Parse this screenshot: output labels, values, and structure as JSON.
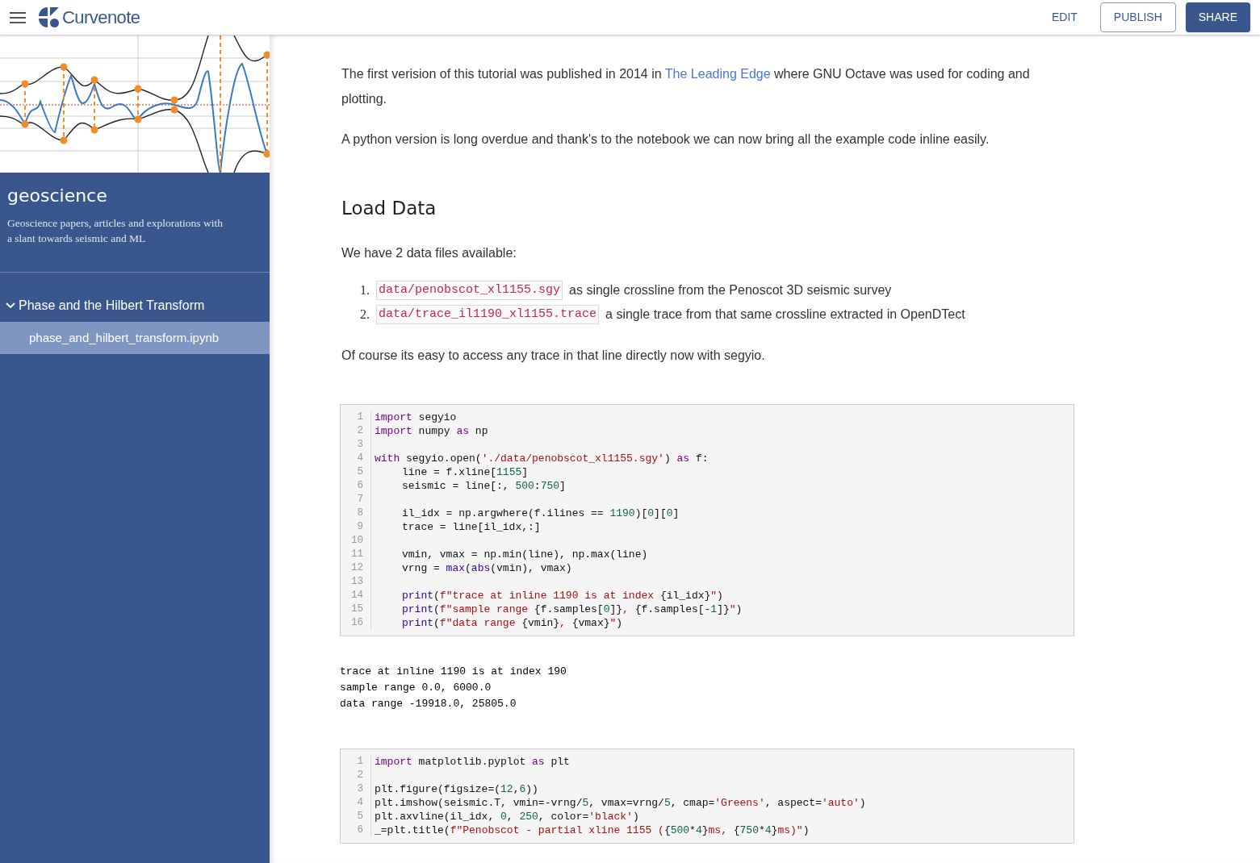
{
  "header": {
    "brand": "Curvenote",
    "actions": [
      {
        "label": "EDIT",
        "kind": "text"
      },
      {
        "label": "PUBLISH",
        "kind": "outlined"
      },
      {
        "label": "SHARE",
        "kind": "filled"
      }
    ]
  },
  "sidebar": {
    "title": "geoscience",
    "description": "Geoscience papers, articles and explorations with a slant towards seismic and ML",
    "nav": [
      {
        "label": "Phase and the Hilbert Transform",
        "expanded": true,
        "children": [
          {
            "label": "phase_and_hilbert_transform.ipynb",
            "selected": true
          }
        ]
      }
    ]
  },
  "content": [
    {
      "kind": "paragraph",
      "before": "The first verision of this tutorial was published in 2014 in ",
      "link": "The Leading Edge",
      "after": " where GNU Octave was used for coding and plotting."
    },
    {
      "kind": "paragraph",
      "before": "A python version is long overdue and thank's to the notebook we can now bring all the example code inline easily."
    },
    {
      "kind": "heading",
      "text": "Load Data"
    },
    {
      "kind": "paragraph",
      "before": "We have 2 data files available:"
    },
    {
      "kind": "list",
      "items": [
        {
          "marker": "1.",
          "code": "data/penobscot_xl1155.sgy",
          "text": "as single crossline from the Penoscot 3D seismic survey"
        },
        {
          "marker": "2.",
          "code": "data/trace_il1190_xl1155.trace",
          "text": "a single trace from that same crossline extracted in OpenDTect"
        }
      ]
    },
    {
      "kind": "paragraph",
      "before": "Of course its easy to access any trace in that line directly now with segyio."
    },
    {
      "kind": "code",
      "lines": [
        {
          "n": "1",
          "indent": false,
          "tokens": [
            {
              "kind": "keyword",
              "text": "import"
            },
            {
              "kind": "plain",
              "text": " segyio"
            }
          ]
        },
        {
          "n": "2",
          "indent": false,
          "tokens": [
            {
              "kind": "keyword",
              "text": "import"
            },
            {
              "kind": "plain",
              "text": " numpy "
            },
            {
              "kind": "keyword",
              "text": "as"
            },
            {
              "kind": "plain",
              "text": " np"
            }
          ]
        },
        {
          "n": "3",
          "indent": false
        },
        {
          "n": "4",
          "indent": false,
          "tokens": [
            {
              "kind": "keyword",
              "text": "with"
            },
            {
              "kind": "plain",
              "text": " segyio.open("
            },
            {
              "kind": "string",
              "text": "'./data/penobscot_xl1155.sgy'"
            },
            {
              "kind": "plain",
              "text": ") "
            },
            {
              "kind": "keyword",
              "text": "as"
            },
            {
              "kind": "plain",
              "text": " f:"
            }
          ]
        },
        {
          "n": "5",
          "indent": true,
          "tokens": [
            {
              "kind": "plain",
              "text": "line = f.xline["
            },
            {
              "kind": "number",
              "text": "1155"
            },
            {
              "kind": "plain",
              "text": "]"
            }
          ]
        },
        {
          "n": "6",
          "indent": true,
          "tokens": [
            {
              "kind": "plain",
              "text": "seismic = line[:, "
            },
            {
              "kind": "number",
              "text": "500"
            },
            {
              "kind": "plain",
              "text": ":"
            },
            {
              "kind": "number",
              "text": "750"
            },
            {
              "kind": "plain",
              "text": "]"
            }
          ]
        },
        {
          "n": "7",
          "indent": false
        },
        {
          "n": "8",
          "indent": true,
          "tokens": [
            {
              "kind": "plain",
              "text": "il_idx = np.argwhere(f.ilines == "
            },
            {
              "kind": "number",
              "text": "1190"
            },
            {
              "kind": "plain",
              "text": ")["
            },
            {
              "kind": "number",
              "text": "0"
            },
            {
              "kind": "plain",
              "text": "]["
            },
            {
              "kind": "number",
              "text": "0"
            },
            {
              "kind": "plain",
              "text": "]"
            }
          ]
        },
        {
          "n": "9",
          "indent": true,
          "tokens": [
            {
              "kind": "plain",
              "text": "trace = line[il_idx,:]"
            }
          ]
        },
        {
          "n": "10",
          "indent": false
        },
        {
          "n": "11",
          "indent": true,
          "tokens": [
            {
              "kind": "plain",
              "text": "vmin, vmax = np.min(line), np.max(line)"
            }
          ]
        },
        {
          "n": "12",
          "indent": true,
          "tokens": [
            {
              "kind": "plain",
              "text": "vrng = "
            },
            {
              "kind": "builtin",
              "text": "max"
            },
            {
              "kind": "plain",
              "text": "("
            },
            {
              "kind": "builtin",
              "text": "abs"
            },
            {
              "kind": "plain",
              "text": "(vmin), vmax)"
            }
          ]
        },
        {
          "n": "13",
          "indent": false
        },
        {
          "n": "14",
          "indent": true,
          "tokens": [
            {
              "kind": "builtin",
              "text": "print"
            },
            {
              "kind": "plain",
              "text": "("
            },
            {
              "kind": "string",
              "text": "f\"trace at inline 1190 is at index "
            },
            {
              "kind": "plain",
              "text": "{il_idx}"
            },
            {
              "kind": "string",
              "text": "\""
            },
            {
              "kind": "plain",
              "text": ")"
            }
          ]
        },
        {
          "n": "15",
          "indent": true,
          "tokens": [
            {
              "kind": "builtin",
              "text": "print"
            },
            {
              "kind": "plain",
              "text": "("
            },
            {
              "kind": "string",
              "text": "f\"sample range "
            },
            {
              "kind": "plain",
              "text": "{f.samples["
            },
            {
              "kind": "number",
              "text": "0"
            },
            {
              "kind": "plain",
              "text": "]}"
            },
            {
              "kind": "string",
              "text": ", "
            },
            {
              "kind": "plain",
              "text": "{f.samples[-"
            },
            {
              "kind": "number",
              "text": "1"
            },
            {
              "kind": "plain",
              "text": "]}"
            },
            {
              "kind": "string",
              "text": "\""
            },
            {
              "kind": "plain",
              "text": ")"
            }
          ]
        },
        {
          "n": "16",
          "indent": true,
          "tokens": [
            {
              "kind": "builtin",
              "text": "print"
            },
            {
              "kind": "plain",
              "text": "("
            },
            {
              "kind": "string",
              "text": "f\"data range "
            },
            {
              "kind": "plain",
              "text": "{vmin}"
            },
            {
              "kind": "string",
              "text": ", "
            },
            {
              "kind": "plain",
              "text": "{vmax}"
            },
            {
              "kind": "string",
              "text": "\""
            },
            {
              "kind": "plain",
              "text": ")"
            }
          ]
        }
      ]
    },
    {
      "kind": "output",
      "lines": [
        "trace at inline 1190 is at index 190",
        "sample range 0.0, 6000.0",
        "data range -19918.0, 25805.0"
      ]
    },
    {
      "kind": "code",
      "lines": [
        {
          "n": "1",
          "indent": false,
          "tokens": [
            {
              "kind": "keyword",
              "text": "import"
            },
            {
              "kind": "plain",
              "text": " matplotlib.pyplot "
            },
            {
              "kind": "keyword",
              "text": "as"
            },
            {
              "kind": "plain",
              "text": " plt"
            }
          ]
        },
        {
          "n": "2",
          "indent": false
        },
        {
          "n": "3",
          "indent": false,
          "tokens": [
            {
              "kind": "plain",
              "text": "plt.figure(figsize=("
            },
            {
              "kind": "number",
              "text": "12"
            },
            {
              "kind": "plain",
              "text": ","
            },
            {
              "kind": "number",
              "text": "6"
            },
            {
              "kind": "plain",
              "text": "))"
            }
          ]
        },
        {
          "n": "4",
          "indent": false,
          "tokens": [
            {
              "kind": "plain",
              "text": "plt.imshow(seismic.T, vmin=-vrng/"
            },
            {
              "kind": "number",
              "text": "5"
            },
            {
              "kind": "plain",
              "text": ", vmax=vrng/"
            },
            {
              "kind": "number",
              "text": "5"
            },
            {
              "kind": "plain",
              "text": ", cmap="
            },
            {
              "kind": "string",
              "text": "'Greens'"
            },
            {
              "kind": "plain",
              "text": ", aspect="
            },
            {
              "kind": "string",
              "text": "'auto'"
            },
            {
              "kind": "plain",
              "text": ")"
            }
          ]
        },
        {
          "n": "5",
          "indent": false,
          "tokens": [
            {
              "kind": "plain",
              "text": "plt.axvline(il_idx, "
            },
            {
              "kind": "number",
              "text": "0"
            },
            {
              "kind": "plain",
              "text": ", "
            },
            {
              "kind": "number",
              "text": "250"
            },
            {
              "kind": "plain",
              "text": ", color="
            },
            {
              "kind": "string",
              "text": "'black'"
            },
            {
              "kind": "plain",
              "text": ")"
            }
          ]
        },
        {
          "n": "6",
          "indent": false,
          "tokens": [
            {
              "kind": "plain",
              "text": "_=plt.title("
            },
            {
              "kind": "string",
              "text": "f\"Penobscot - partial xline 1155 ("
            },
            {
              "kind": "plain",
              "text": "{"
            },
            {
              "kind": "number",
              "text": "500"
            },
            {
              "kind": "plain",
              "text": "*"
            },
            {
              "kind": "number",
              "text": "4"
            },
            {
              "kind": "plain",
              "text": "}"
            },
            {
              "kind": "string",
              "text": "ms, "
            },
            {
              "kind": "plain",
              "text": "{"
            },
            {
              "kind": "number",
              "text": "750"
            },
            {
              "kind": "plain",
              "text": "*"
            },
            {
              "kind": "number",
              "text": "4"
            },
            {
              "kind": "plain",
              "text": "}"
            },
            {
              "kind": "string",
              "text": "ms)\""
            },
            {
              "kind": "plain",
              "text": ")"
            }
          ]
        }
      ]
    }
  ]
}
